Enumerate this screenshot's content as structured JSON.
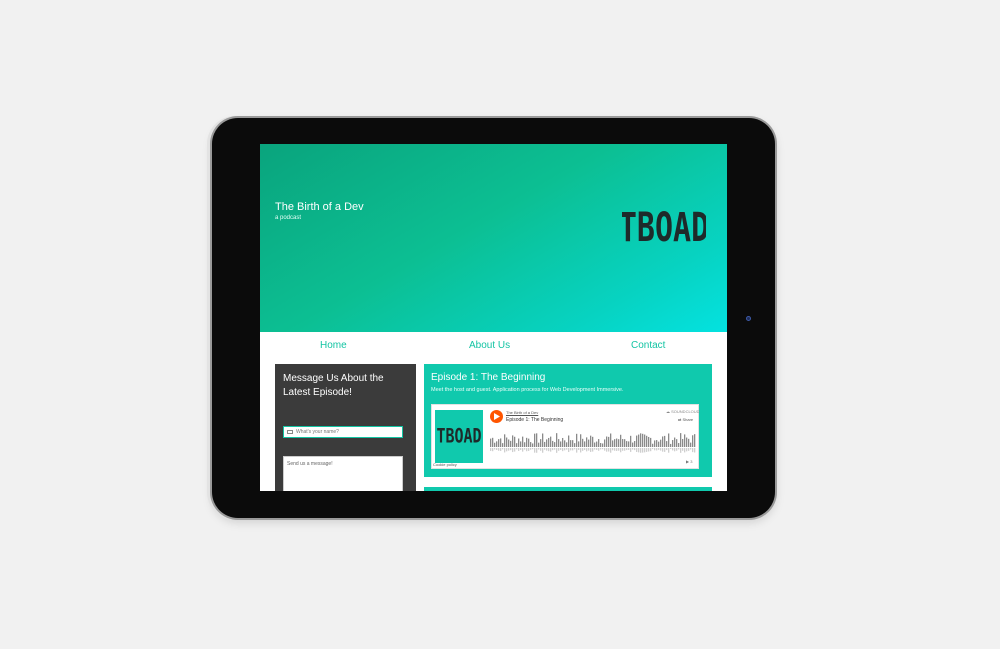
{
  "hero": {
    "title": "The Birth of a Dev",
    "subtitle": "a podcast",
    "logo_text": "TBOAD"
  },
  "nav": {
    "items": [
      "Home",
      "About Us",
      "Contact"
    ]
  },
  "contact_form": {
    "title": "Message Us About the Latest Episode!",
    "name_placeholder": "What's your name?",
    "message_placeholder": "Send us a message!"
  },
  "episode": {
    "title": "Episode 1: The Beginning",
    "description": "Meet the host and guest. Application process for Web Development Immersive.",
    "player": {
      "artist": "The Birth of a Dev",
      "track": "Episode 1: The Beginning",
      "source": "SOUNDCLOUD",
      "share_label": "Share",
      "cookie_label": "Cookie policy",
      "art_text": "TBOAD",
      "play_count": "3"
    }
  },
  "colors": {
    "accent": "#13c4a3",
    "hero_start": "#0aa47d",
    "hero_end": "#04e2e0",
    "sidebar_bg": "#3b3b3b",
    "play_button": "#ff5500"
  }
}
